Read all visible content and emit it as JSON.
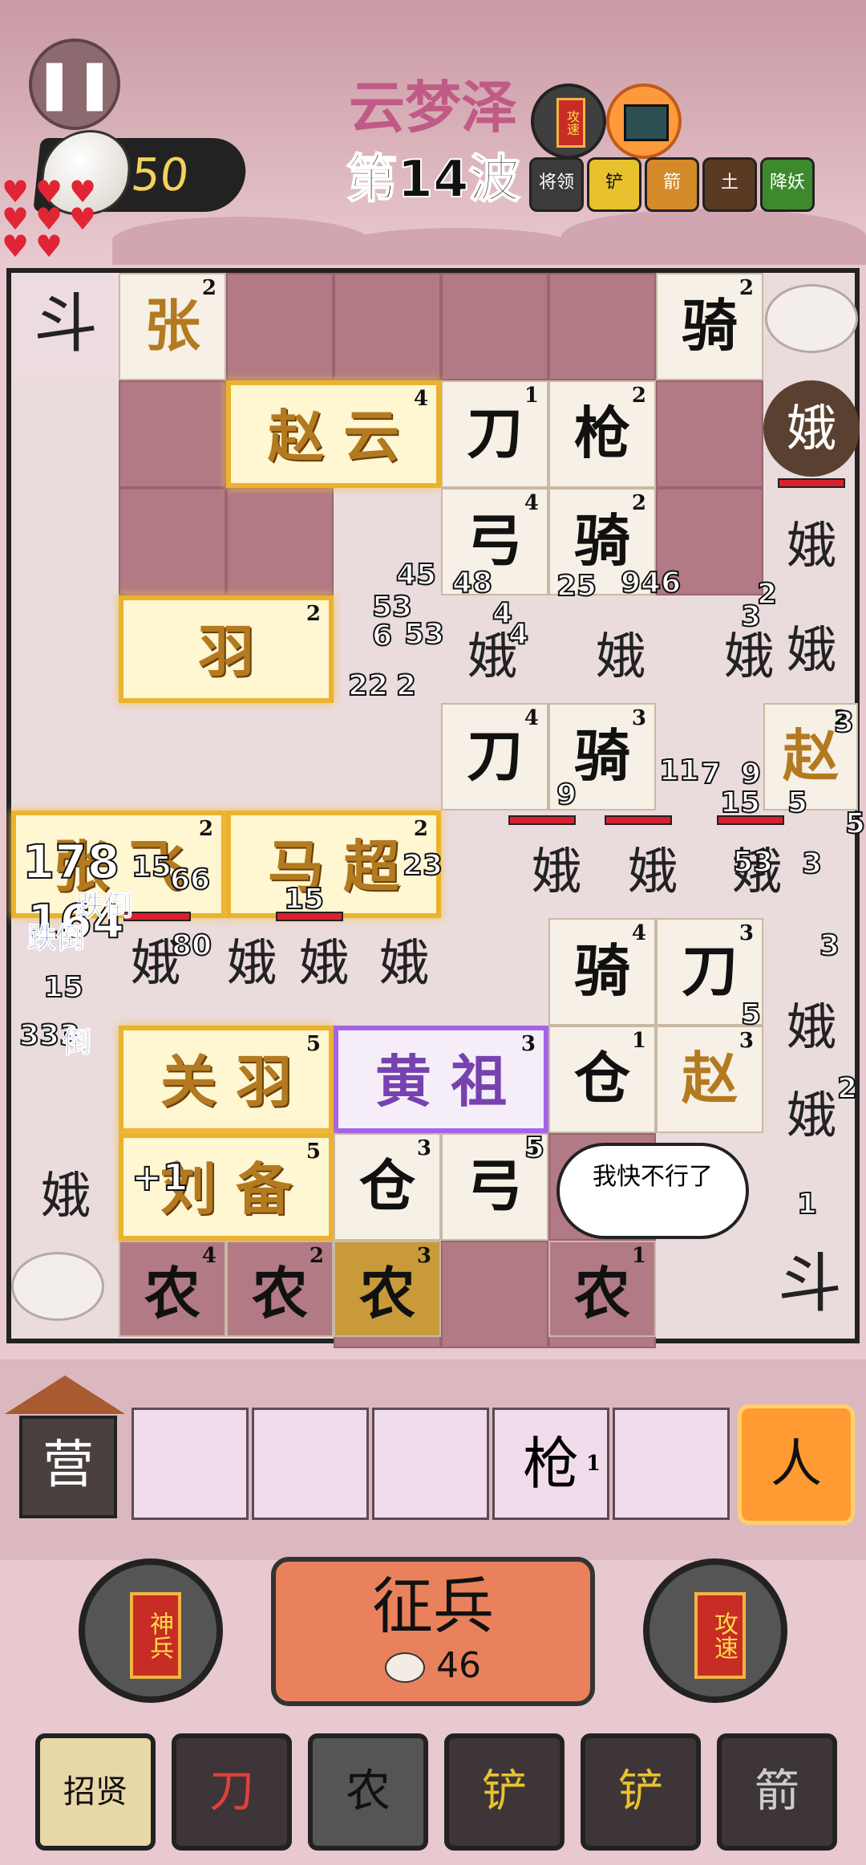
{
  "header": {
    "level_name": "云梦泽",
    "wave_label": "第14波",
    "money": "50",
    "hearts": 8,
    "top_buttons": [
      "攻速",
      "锦囊"
    ],
    "skills": [
      "将领",
      "铲",
      "箭",
      "土",
      "降妖"
    ]
  },
  "board": {
    "units": [
      {
        "text": "张",
        "level": "2"
      },
      {
        "text": "骑",
        "level": "2"
      },
      {
        "text": "赵 云",
        "level": "4",
        "style": "gold"
      },
      {
        "text": "刀",
        "level": "1"
      },
      {
        "text": "枪",
        "level": "2"
      },
      {
        "text": "弓",
        "level": "4"
      },
      {
        "text": "骑",
        "level": "2"
      },
      {
        "text": "羽",
        "level": "2",
        "style": "gold"
      },
      {
        "text": "刀",
        "level": "4"
      },
      {
        "text": "骑",
        "level": "3"
      },
      {
        "text": "赵",
        "level": "2"
      },
      {
        "text": "张 飞",
        "level": "2",
        "style": "gold"
      },
      {
        "text": "马 超",
        "level": "2",
        "style": "gold"
      },
      {
        "text": "骑",
        "level": "4"
      },
      {
        "text": "刀",
        "level": "3"
      },
      {
        "text": "关 羽",
        "level": "5",
        "style": "gold"
      },
      {
        "text": "黄 祖",
        "level": "3",
        "style": "purple"
      },
      {
        "text": "仓",
        "level": "1"
      },
      {
        "text": "赵",
        "level": "3"
      },
      {
        "text": "刘 备",
        "level": "5",
        "style": "gold"
      },
      {
        "text": "仓",
        "level": "3"
      },
      {
        "text": "弓",
        "level": "5"
      },
      {
        "text": "农",
        "level": "4"
      },
      {
        "text": "农",
        "level": "2"
      },
      {
        "text": "农",
        "level": "3"
      },
      {
        "text": "农",
        "level": "1"
      },
      {
        "text": "斗",
        "level": ""
      },
      {
        "text": "斗",
        "level": ""
      }
    ],
    "enemy_char": "娥",
    "damage_numbers": [
      "45",
      "48",
      "25",
      "946",
      "53",
      "53",
      "6",
      "22",
      "2",
      "4",
      "3",
      "2",
      "11",
      "7",
      "9",
      "9",
      "15",
      "5",
      "5",
      "178",
      "15",
      "66",
      "164",
      "15",
      "23",
      "80",
      "15",
      "333",
      "5",
      "53",
      "3",
      "3",
      "2",
      "3",
      "4",
      "5",
      "1"
    ],
    "status_tags": [
      "跌倒",
      "跌倒",
      "倒"
    ],
    "speech": "我快不行了",
    "plus_text": "+1"
  },
  "bench": {
    "camp_label": "营",
    "slots": [
      {
        "text": "",
        "level": ""
      },
      {
        "text": "",
        "level": ""
      },
      {
        "text": "",
        "level": ""
      },
      {
        "text": "枪",
        "level": "1"
      },
      {
        "text": "",
        "level": ""
      }
    ],
    "ad_button": "人"
  },
  "controls": {
    "left_card": "神兵",
    "recruit_label": "征兵",
    "recruit_cost": "46",
    "right_card": "攻速"
  },
  "toolbar": [
    "招贤",
    "刀",
    "农",
    "铲",
    "铲",
    "箭"
  ]
}
